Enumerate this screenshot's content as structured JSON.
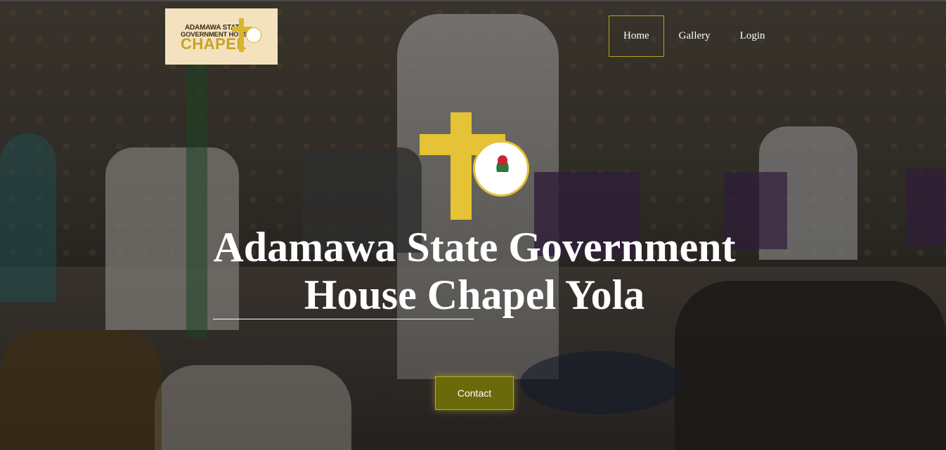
{
  "logo": {
    "line1": "ADAMAWA STATE",
    "line2": "GOVERNMENT HOUSE",
    "line3": "CHAPEL"
  },
  "nav": {
    "items": [
      {
        "label": "Home",
        "active": true
      },
      {
        "label": "Gallery",
        "active": false
      },
      {
        "label": "Login",
        "active": false
      }
    ]
  },
  "hero": {
    "title": "Adamawa State Government House Chapel Yola",
    "contact_label": "Contact",
    "emblem_icon": "cross-and-seal-icon"
  },
  "colors": {
    "accent": "#e5c236",
    "button_bg": "#6b6a0a",
    "nav_border": "#b5a41d"
  }
}
